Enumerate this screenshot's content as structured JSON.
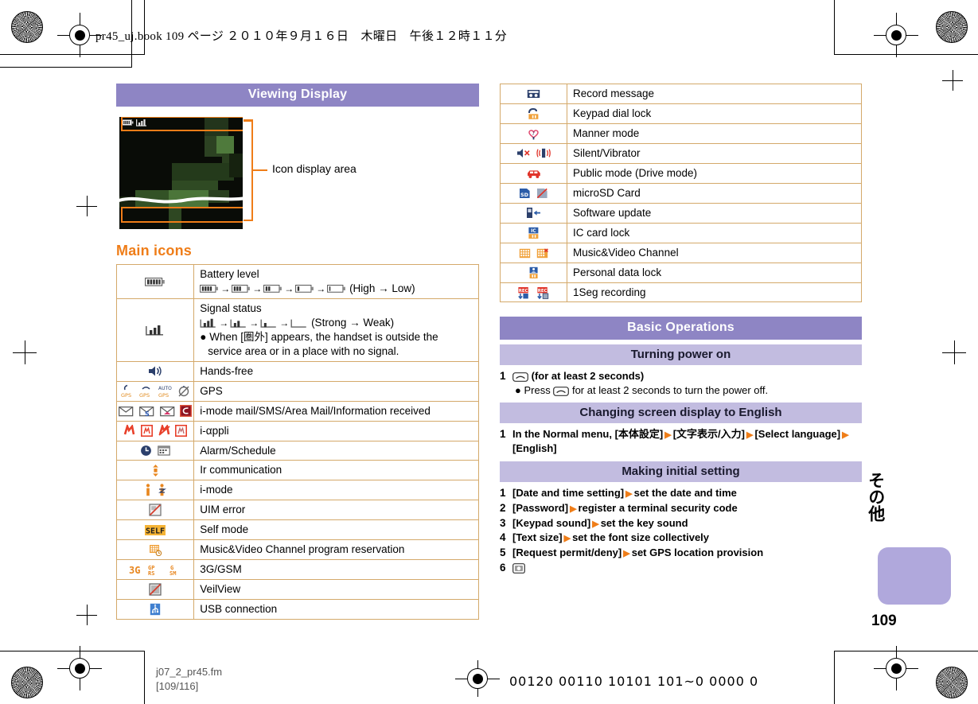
{
  "print_slug": "pr45_uj.book  109 ページ  ２０１０年９月１６日　木曜日　午後１２時１１分",
  "left_column": {
    "section_title": "Viewing Display",
    "diagram": {
      "callout_label": "Icon display area"
    },
    "subheading": "Main icons",
    "table_rows": [
      {
        "icon": "battery-icon",
        "title": "Battery level",
        "detail": "(High → Low)"
      },
      {
        "icon": "signal-icon",
        "title": "Signal status",
        "detail": "(Strong → Weak)",
        "note": "When [圏外] appears, the handset is outside the service area or in a place with no signal."
      },
      {
        "icon": "hands-free-icon",
        "title": "Hands-free"
      },
      {
        "icon": "gps-icon",
        "title": "GPS"
      },
      {
        "icon": "mail-icon",
        "title": "i-mode mail/SMS/Area Mail/Information received"
      },
      {
        "icon": "i-appli-icon",
        "title": "i-αppli"
      },
      {
        "icon": "alarm-schedule-icon",
        "title": "Alarm/Schedule"
      },
      {
        "icon": "ir-icon",
        "title": "Ir communication"
      },
      {
        "icon": "i-mode-icon",
        "title": "i-mode"
      },
      {
        "icon": "uim-error-icon",
        "title": "UIM error"
      },
      {
        "icon": "self-mode-icon",
        "title": "Self mode"
      },
      {
        "icon": "music-video-reservation-icon",
        "title": "Music&Video Channel program reservation"
      },
      {
        "icon": "3g-gsm-icon",
        "title": "3G/GSM"
      },
      {
        "icon": "veilview-icon",
        "title": "VeilView"
      },
      {
        "icon": "usb-icon",
        "title": "USB connection"
      }
    ]
  },
  "right_column": {
    "table_rows": [
      {
        "icon": "record-message-icon",
        "title": "Record message"
      },
      {
        "icon": "keypad-dial-lock-icon",
        "title": "Keypad dial lock"
      },
      {
        "icon": "manner-mode-icon",
        "title": "Manner mode"
      },
      {
        "icon": "silent-vibrator-icon",
        "title": "Silent/Vibrator"
      },
      {
        "icon": "public-drive-mode-icon",
        "title": "Public mode (Drive mode)"
      },
      {
        "icon": "microsd-icon",
        "title": "microSD Card"
      },
      {
        "icon": "software-update-icon",
        "title": "Software update"
      },
      {
        "icon": "ic-card-lock-icon",
        "title": "IC card lock"
      },
      {
        "icon": "music-video-channel-icon",
        "title": "Music&Video Channel"
      },
      {
        "icon": "personal-data-lock-icon",
        "title": "Personal data lock"
      },
      {
        "icon": "1seg-recording-icon",
        "title": "1Seg recording"
      }
    ],
    "section_title": "Basic Operations",
    "turning_power_on": {
      "subtitle": "Turning power on",
      "step_1_text": "(for at least 2 seconds)",
      "note": "Press   for at least 2 seconds to turn the power off.",
      "note_prefix": "Press",
      "note_suffix": "for at least 2 seconds to turn the power off."
    },
    "changing_language": {
      "subtitle": "Changing screen display to English",
      "step_1_a": "In the Normal menu, [本体設定]",
      "step_1_b": "[文字表示/入力]",
      "step_1_c": "[Select language]",
      "step_1_d": "[English]"
    },
    "initial_setting": {
      "subtitle": "Making initial setting",
      "steps": [
        {
          "n": "1",
          "a": "[Date and time setting]",
          "b": "set the date and time"
        },
        {
          "n": "2",
          "a": "[Password]",
          "b": "register a terminal security code"
        },
        {
          "n": "3",
          "a": "[Keypad sound]",
          "b": "set the key sound"
        },
        {
          "n": "4",
          "a": "[Text size]",
          "b": "set the font size collectively"
        },
        {
          "n": "5",
          "a": "[Request permit/deny]",
          "b": "set GPS location provision"
        },
        {
          "n": "6",
          "a": "",
          "b": ""
        }
      ]
    }
  },
  "side_tab": {
    "label": "その他",
    "page_number": "109"
  },
  "footer": {
    "filename": "j07_2_pr45.fm",
    "page_ref": "[109/116]",
    "printer_code": "00120 00110 10101 101~0 0000 0"
  },
  "colors": {
    "section_bar": "#8e85c4",
    "sub_bar": "#c2bce0",
    "accent_orange": "#ef7d18",
    "table_border": "#d4a96a",
    "tab_block": "#b0a8dc"
  }
}
